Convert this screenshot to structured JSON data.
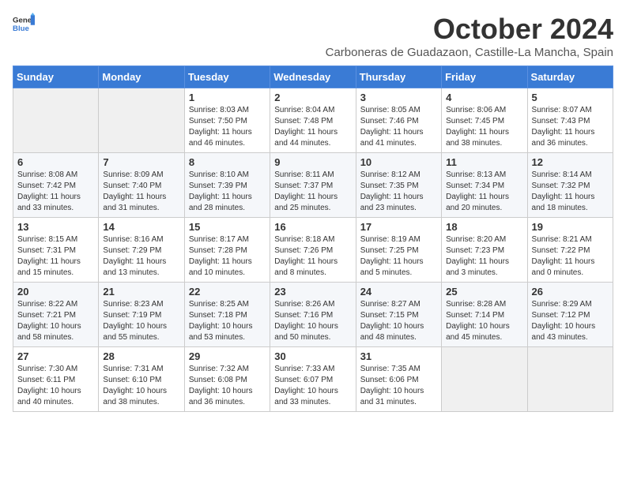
{
  "header": {
    "logo_general": "General",
    "logo_blue": "Blue",
    "month_title": "October 2024",
    "location": "Carboneras de Guadazaon, Castille-La Mancha, Spain"
  },
  "weekdays": [
    "Sunday",
    "Monday",
    "Tuesday",
    "Wednesday",
    "Thursday",
    "Friday",
    "Saturday"
  ],
  "weeks": [
    [
      {
        "day": "",
        "info": ""
      },
      {
        "day": "",
        "info": ""
      },
      {
        "day": "1",
        "info": "Sunrise: 8:03 AM\nSunset: 7:50 PM\nDaylight: 11 hours\nand 46 minutes."
      },
      {
        "day": "2",
        "info": "Sunrise: 8:04 AM\nSunset: 7:48 PM\nDaylight: 11 hours\nand 44 minutes."
      },
      {
        "day": "3",
        "info": "Sunrise: 8:05 AM\nSunset: 7:46 PM\nDaylight: 11 hours\nand 41 minutes."
      },
      {
        "day": "4",
        "info": "Sunrise: 8:06 AM\nSunset: 7:45 PM\nDaylight: 11 hours\nand 38 minutes."
      },
      {
        "day": "5",
        "info": "Sunrise: 8:07 AM\nSunset: 7:43 PM\nDaylight: 11 hours\nand 36 minutes."
      }
    ],
    [
      {
        "day": "6",
        "info": "Sunrise: 8:08 AM\nSunset: 7:42 PM\nDaylight: 11 hours\nand 33 minutes."
      },
      {
        "day": "7",
        "info": "Sunrise: 8:09 AM\nSunset: 7:40 PM\nDaylight: 11 hours\nand 31 minutes."
      },
      {
        "day": "8",
        "info": "Sunrise: 8:10 AM\nSunset: 7:39 PM\nDaylight: 11 hours\nand 28 minutes."
      },
      {
        "day": "9",
        "info": "Sunrise: 8:11 AM\nSunset: 7:37 PM\nDaylight: 11 hours\nand 25 minutes."
      },
      {
        "day": "10",
        "info": "Sunrise: 8:12 AM\nSunset: 7:35 PM\nDaylight: 11 hours\nand 23 minutes."
      },
      {
        "day": "11",
        "info": "Sunrise: 8:13 AM\nSunset: 7:34 PM\nDaylight: 11 hours\nand 20 minutes."
      },
      {
        "day": "12",
        "info": "Sunrise: 8:14 AM\nSunset: 7:32 PM\nDaylight: 11 hours\nand 18 minutes."
      }
    ],
    [
      {
        "day": "13",
        "info": "Sunrise: 8:15 AM\nSunset: 7:31 PM\nDaylight: 11 hours\nand 15 minutes."
      },
      {
        "day": "14",
        "info": "Sunrise: 8:16 AM\nSunset: 7:29 PM\nDaylight: 11 hours\nand 13 minutes."
      },
      {
        "day": "15",
        "info": "Sunrise: 8:17 AM\nSunset: 7:28 PM\nDaylight: 11 hours\nand 10 minutes."
      },
      {
        "day": "16",
        "info": "Sunrise: 8:18 AM\nSunset: 7:26 PM\nDaylight: 11 hours\nand 8 minutes."
      },
      {
        "day": "17",
        "info": "Sunrise: 8:19 AM\nSunset: 7:25 PM\nDaylight: 11 hours\nand 5 minutes."
      },
      {
        "day": "18",
        "info": "Sunrise: 8:20 AM\nSunset: 7:23 PM\nDaylight: 11 hours\nand 3 minutes."
      },
      {
        "day": "19",
        "info": "Sunrise: 8:21 AM\nSunset: 7:22 PM\nDaylight: 11 hours\nand 0 minutes."
      }
    ],
    [
      {
        "day": "20",
        "info": "Sunrise: 8:22 AM\nSunset: 7:21 PM\nDaylight: 10 hours\nand 58 minutes."
      },
      {
        "day": "21",
        "info": "Sunrise: 8:23 AM\nSunset: 7:19 PM\nDaylight: 10 hours\nand 55 minutes."
      },
      {
        "day": "22",
        "info": "Sunrise: 8:25 AM\nSunset: 7:18 PM\nDaylight: 10 hours\nand 53 minutes."
      },
      {
        "day": "23",
        "info": "Sunrise: 8:26 AM\nSunset: 7:16 PM\nDaylight: 10 hours\nand 50 minutes."
      },
      {
        "day": "24",
        "info": "Sunrise: 8:27 AM\nSunset: 7:15 PM\nDaylight: 10 hours\nand 48 minutes."
      },
      {
        "day": "25",
        "info": "Sunrise: 8:28 AM\nSunset: 7:14 PM\nDaylight: 10 hours\nand 45 minutes."
      },
      {
        "day": "26",
        "info": "Sunrise: 8:29 AM\nSunset: 7:12 PM\nDaylight: 10 hours\nand 43 minutes."
      }
    ],
    [
      {
        "day": "27",
        "info": "Sunrise: 7:30 AM\nSunset: 6:11 PM\nDaylight: 10 hours\nand 40 minutes."
      },
      {
        "day": "28",
        "info": "Sunrise: 7:31 AM\nSunset: 6:10 PM\nDaylight: 10 hours\nand 38 minutes."
      },
      {
        "day": "29",
        "info": "Sunrise: 7:32 AM\nSunset: 6:08 PM\nDaylight: 10 hours\nand 36 minutes."
      },
      {
        "day": "30",
        "info": "Sunrise: 7:33 AM\nSunset: 6:07 PM\nDaylight: 10 hours\nand 33 minutes."
      },
      {
        "day": "31",
        "info": "Sunrise: 7:35 AM\nSunset: 6:06 PM\nDaylight: 10 hours\nand 31 minutes."
      },
      {
        "day": "",
        "info": ""
      },
      {
        "day": "",
        "info": ""
      }
    ]
  ]
}
